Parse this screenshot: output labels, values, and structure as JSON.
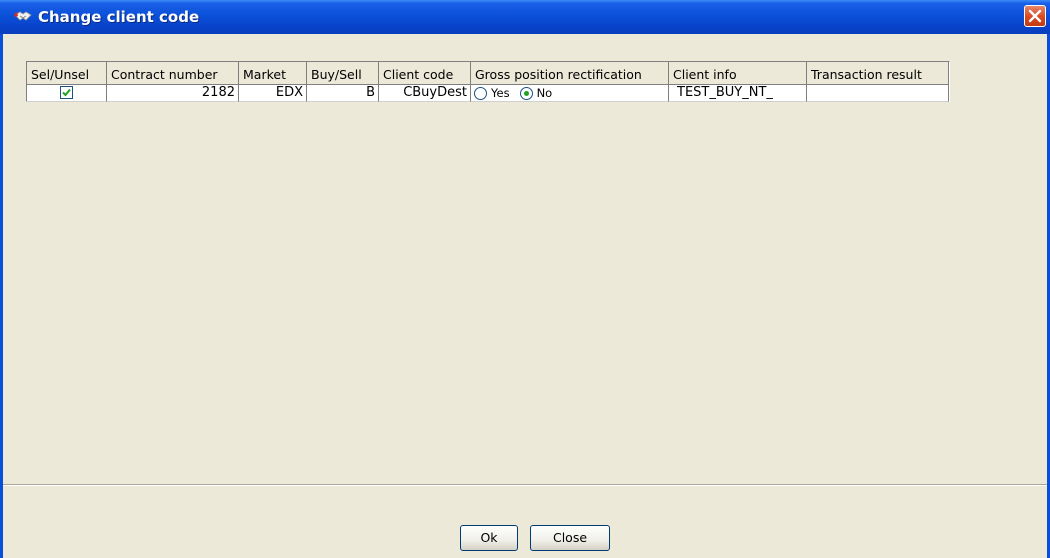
{
  "window": {
    "title": "Change client code"
  },
  "table": {
    "columns": [
      "Sel/Unsel",
      "Contract number",
      "Market",
      "Buy/Sell",
      "Client code",
      "Gross position rectification",
      "Client info",
      "Transaction result"
    ],
    "rows": [
      {
        "selected": true,
        "contract_number": "2182",
        "market": "EDX",
        "buy_sell": "B",
        "client_code": "CBuyDest",
        "gross_yes_label": "Yes",
        "gross_no_label": "No",
        "gross_selected": "No",
        "client_info": "TEST_BUY_NT_",
        "transaction_result": ""
      }
    ]
  },
  "buttons": {
    "ok": "Ok",
    "close": "Close"
  },
  "icons": {
    "title": "handshake-icon",
    "close": "close-x-icon",
    "checkbox": "checkmark-icon"
  },
  "colors": {
    "titlebar": "#0B51D9",
    "close_button": "#D9481F",
    "background": "#ECE9D8",
    "radio_dot": "#21A121"
  }
}
